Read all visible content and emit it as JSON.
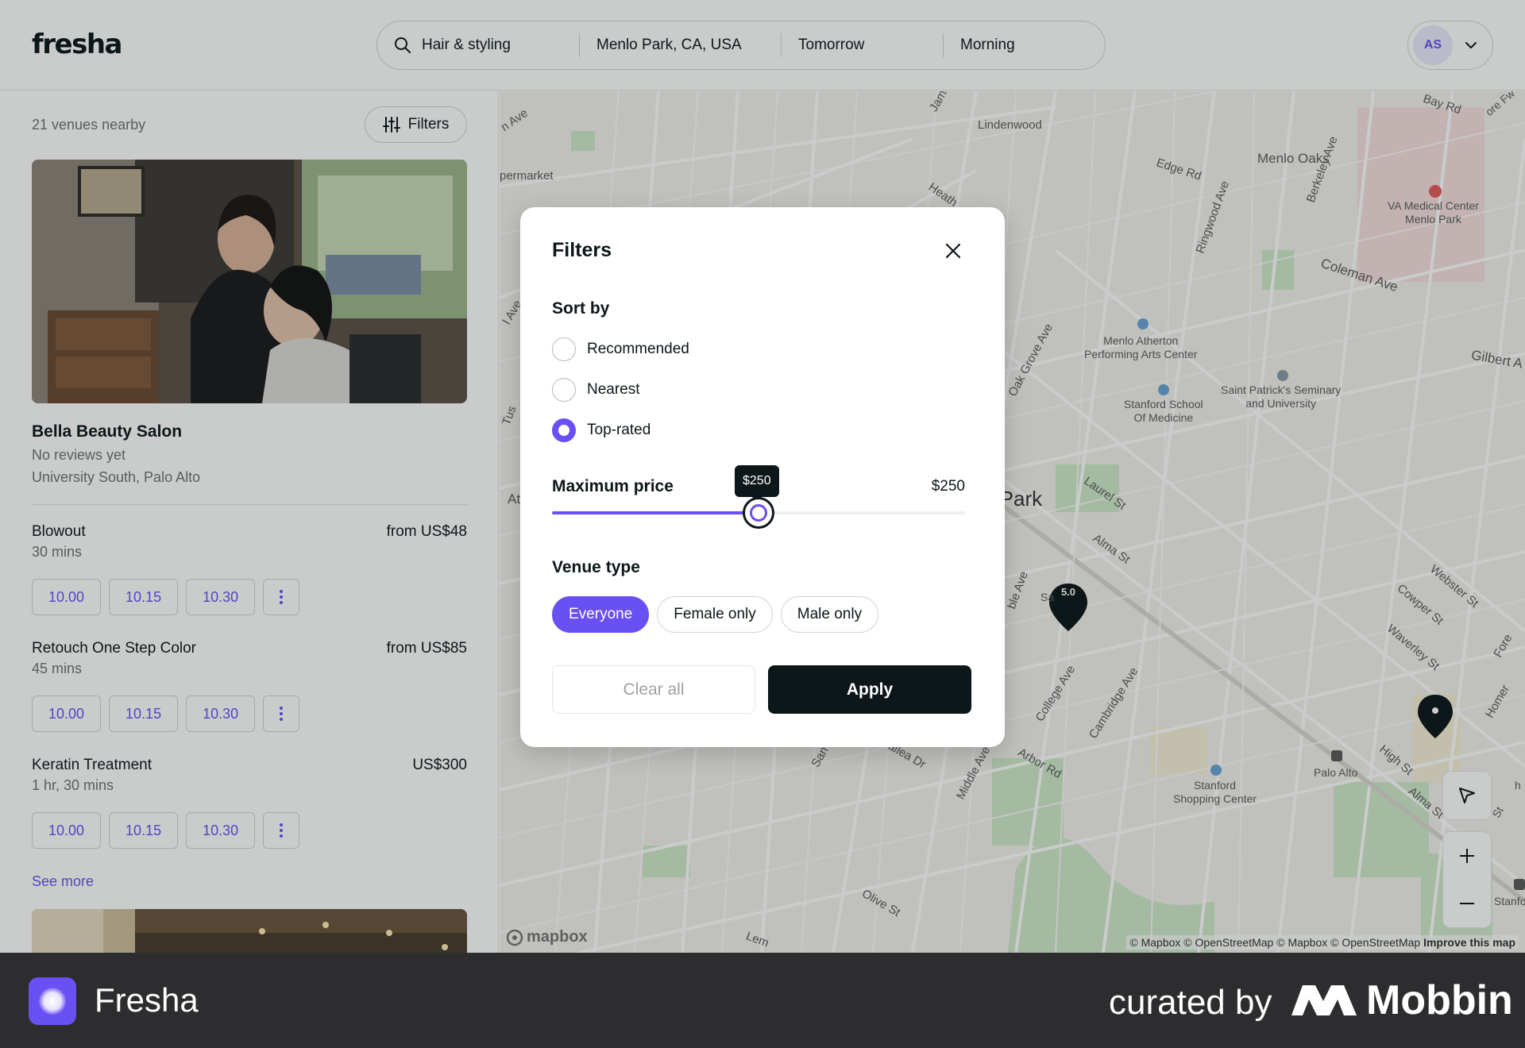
{
  "header": {
    "logo": "fresha",
    "search": {
      "service": "Hair & styling",
      "location": "Menlo Park, CA, USA",
      "date": "Tomorrow",
      "time": "Morning"
    },
    "account_initials": "AS"
  },
  "list": {
    "venue_count": "21 venues nearby",
    "filters_label": "Filters",
    "venue": {
      "name": "Bella Beauty Salon",
      "reviews": "No reviews yet",
      "address": "University South, Palo Alto"
    },
    "services": [
      {
        "name": "Blowout",
        "duration": "30 mins",
        "price": "from US$48",
        "slots": [
          "10.00",
          "10.15",
          "10.30"
        ]
      },
      {
        "name": "Retouch One Step Color",
        "duration": "45 mins",
        "price": "from US$85",
        "slots": [
          "10.00",
          "10.15",
          "10.30"
        ]
      },
      {
        "name": "Keratin Treatment",
        "duration": "1 hr, 30 mins",
        "price": "US$300",
        "slots": [
          "10.00",
          "10.15",
          "10.30"
        ]
      }
    ],
    "see_more": "See more"
  },
  "map": {
    "labels": {
      "lindenwood": "Lindenwood",
      "menlo_oaks": "Menlo Oaks",
      "edge_rd": "Edge Rd",
      "bay_rd": "Bay Rd",
      "va_center": "VA Medical Center\nMenlo Park",
      "coleman_ave": "Coleman Ave",
      "atherton_arts": "Menlo Atherton\nPerforming Arts Center",
      "stanford_med": "Stanford School\nOf Medicine",
      "st_patricks": "Saint Patrick's Seminary\nand University",
      "gilbert": "Gilbert A",
      "park": "o Park",
      "laurel_st": "Laurel St",
      "alma_st": "Alma St",
      "webster_st": "Webster St",
      "cowper_st": "Cowper St",
      "waverley_st": "Waverley St",
      "college_ave": "College Ave",
      "cambridge_ave": "Cambridge Ave",
      "arbor_rd": "Arbor Rd",
      "middle_ave": "Middle Ave",
      "olive_st": "Olive St",
      "stanford_shopping": "Stanford\nShopping Center",
      "palo_alto": "Palo Alto",
      "high_st": "High St",
      "alma_st2": "Alma St",
      "oak_grove": "Oak Grove Ave",
      "ringwood": "Ringwood Ave",
      "berkeley": "Berkeley Ave",
      "supermarket": "permarket",
      "heath": "Heath",
      "jame": "Jame",
      "n_ave": "n Ave",
      "l_ave": "l Ave",
      "tus": "Tus",
      "at": "At",
      "san": "San",
      "vallea": "vallea Dr",
      "lem": "Lem",
      "stanfo": "Stanfo",
      "ble_ave": "ble Ave",
      "homer": "Homer",
      "fore": "Fore",
      "sa": "Sa",
      "h": "h",
      "st": "St",
      "ore_fw": "ore Fw"
    },
    "pin_rating": "5.0",
    "attribution": "© Mapbox © OpenStreetMap © Mapbox © OpenStreetMap",
    "improve": "Improve this map",
    "mapbox": "mapbox"
  },
  "filters_modal": {
    "title": "Filters",
    "sort_title": "Sort by",
    "sort_options": [
      "Recommended",
      "Nearest",
      "Top-rated"
    ],
    "sort_selected": "Top-rated",
    "price_title": "Maximum price",
    "price_value": "$250",
    "price_tooltip": "$250",
    "price_fraction": 0.5,
    "venue_title": "Venue type",
    "venue_options": [
      "Everyone",
      "Female only",
      "Male only"
    ],
    "venue_selected": "Everyone",
    "clear_label": "Clear all",
    "apply_label": "Apply"
  },
  "footer": {
    "app_name": "Fresha",
    "curated_by": "curated by",
    "brand": "Mobbin"
  },
  "colors": {
    "accent": "#6950f3",
    "dark": "#0d1619",
    "footer": "#2d2d2f"
  }
}
